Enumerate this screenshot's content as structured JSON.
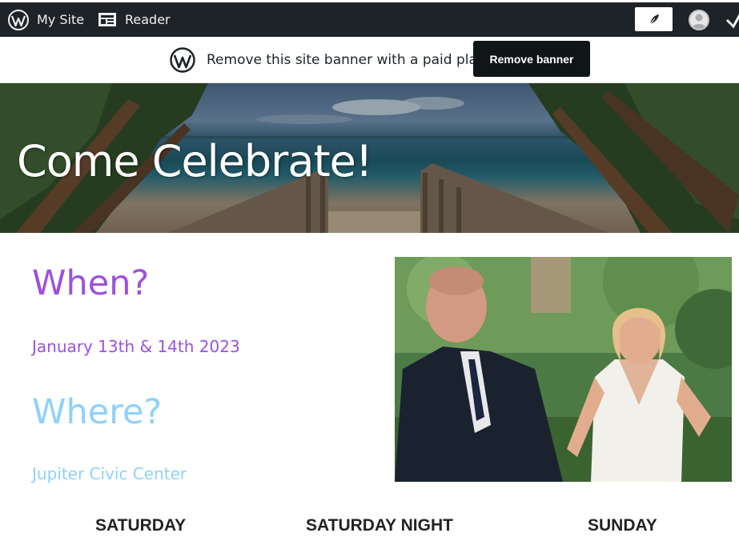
{
  "adminbar": {
    "my_site": "My Site",
    "reader": "Reader",
    "icons": [
      "wordpress-logo-icon",
      "reader-icon",
      "leaf-icon",
      "avatar",
      "notification-icon"
    ]
  },
  "banner": {
    "text": "Remove this site banner with a paid plan",
    "button": "Remove banner"
  },
  "hero": {
    "title": "Come Celebrate!"
  },
  "content": {
    "when_heading": "When?",
    "when_text": "January 13th & 14th 2023",
    "where_heading": "Where?",
    "where_text": "Jupiter Civic Center"
  },
  "schedule": {
    "columns": [
      "SATURDAY",
      "SATURDAY NIGHT",
      "SUNDAY"
    ]
  },
  "colors": {
    "adminbar_bg": "#1d2327",
    "button_bg": "#101517",
    "when_purple": "#9b51e0",
    "where_blue": "#8ed1fc"
  }
}
